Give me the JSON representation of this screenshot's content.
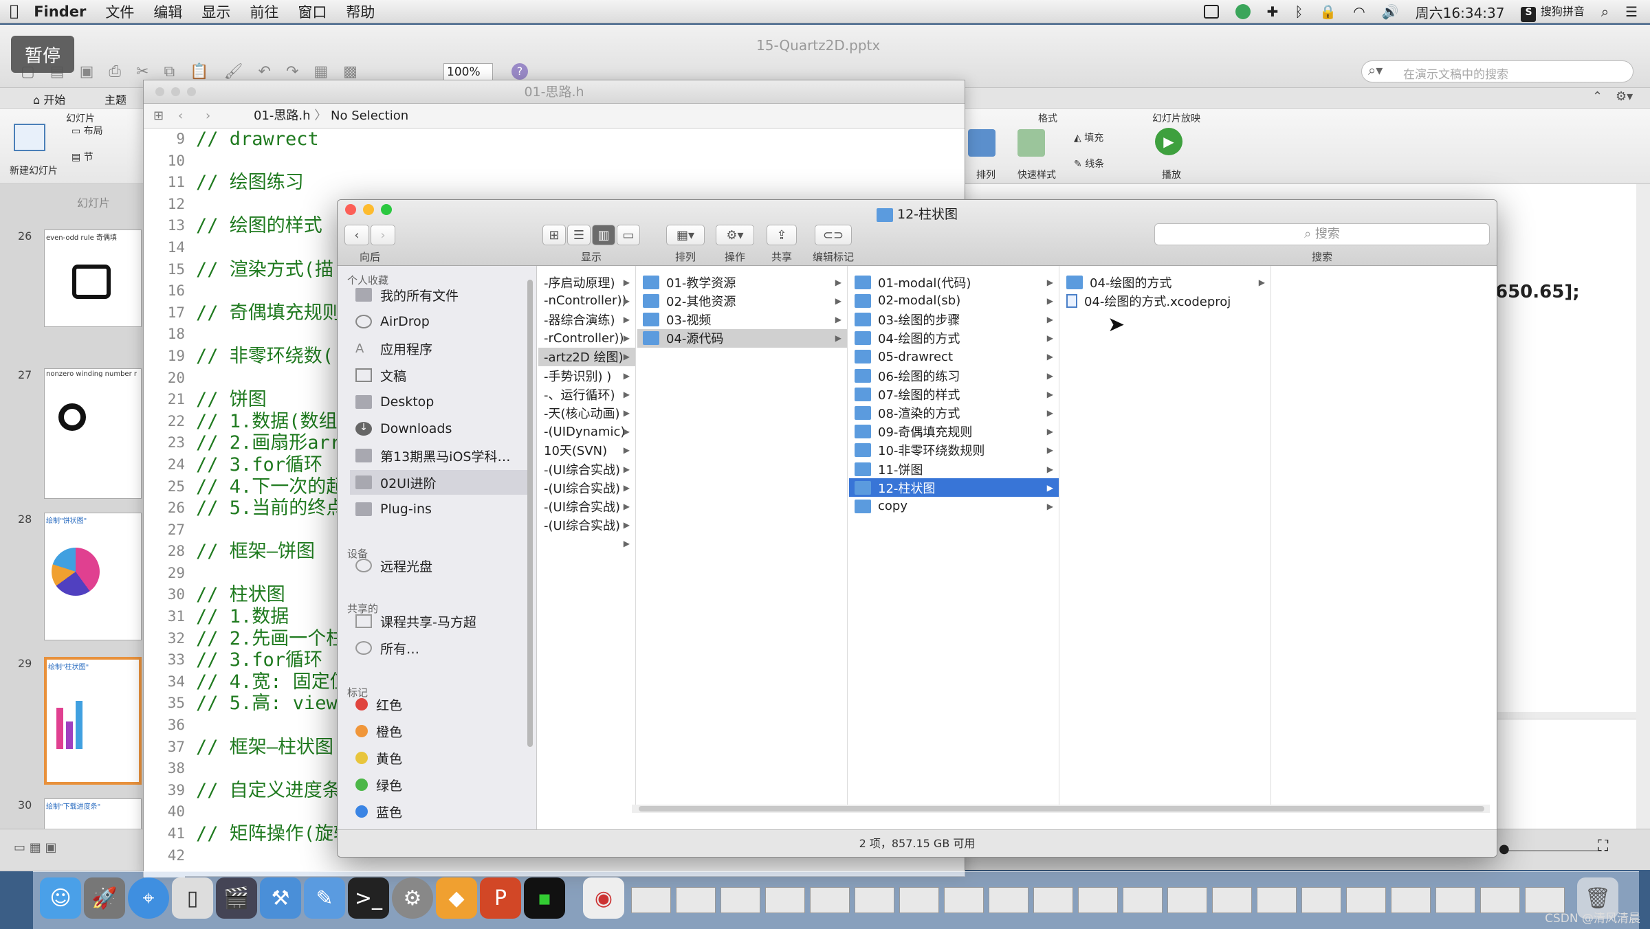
{
  "menubar": {
    "apple": "",
    "app": "Finder",
    "items": [
      "文件",
      "编辑",
      "显示",
      "前往",
      "窗口",
      "帮助"
    ],
    "clock": "周六16:34:37",
    "input_method": "搜狗拼音"
  },
  "pause_label": "暂停",
  "ppt": {
    "title": "15-Quartz2D.pptx",
    "zoom": "100%",
    "search_placeholder": "在演示文稿中的搜索",
    "tabs": [
      "开始",
      "主题"
    ],
    "groups": {
      "slides": "幻灯片",
      "format": "格式",
      "slideshow": "幻灯片放映"
    },
    "buttons": {
      "new_slide": "新建幻灯片",
      "layout": "布局",
      "section": "节",
      "arrange": "排列",
      "quick_style": "快速样式",
      "fill": "填充",
      "line": "线条",
      "play": "播放"
    },
    "slide_tab": "幻灯片",
    "slide_numbers": [
      "26",
      "27",
      "28",
      "29",
      "30"
    ],
    "slide_texts": [
      "even-odd rule 奇偶填",
      "nonzero winding number r",
      "绘制\"饼状图\"",
      "绘制\"柱状图\"",
      "绘制\"下载进度条\""
    ],
    "code_fragment": "650.65];"
  },
  "xcode": {
    "title": "01-思路.h",
    "jump_file": "01-思路.h",
    "jump_sel": "No Selection",
    "line_numbers": [
      "9",
      "10",
      "11",
      "12",
      "13",
      "14",
      "15",
      "16",
      "17",
      "18",
      "19",
      "20",
      "21",
      "22",
      "23",
      "24",
      "25",
      "26",
      "27",
      "28",
      "29",
      "30",
      "31",
      "32",
      "33",
      "34",
      "35",
      "36",
      "37",
      "38",
      "39",
      "40",
      "41",
      "42"
    ],
    "lines": [
      "// drawrect",
      "",
      "// 绘图练习",
      "",
      "// 绘图的样式",
      "",
      "// 渲染方式(描",
      "",
      "// 奇偶填充规则",
      "",
      "// 非零环绕数(",
      "",
      "// 饼图",
      "// 1.数据(数组",
      "// 2.画扇形arr",
      "// 3.for循环",
      "// 4.下一次的起",
      "// 5.当前的终点",
      "",
      "// 框架—饼图",
      "",
      "// 柱状图",
      "// 1.数据",
      "// 2.先画一个柱",
      "// 3.for循环",
      "// 4.宽: 固定值",
      "// 5.高: view",
      "",
      "// 框架—柱状图",
      "",
      "// 自定义进度条",
      "",
      "// 矩阵操作(旋转",
      ""
    ]
  },
  "finder": {
    "title": "12-柱状图",
    "toolbar": {
      "back": "向后",
      "view": "显示",
      "arrange": "排列",
      "action": "操作",
      "share": "共享",
      "tags": "编辑标记",
      "search": "搜索",
      "search_placeholder": "搜索"
    },
    "sidebar": {
      "favorites_header": "个人收藏",
      "favorites": [
        "我的所有文件",
        "AirDrop",
        "应用程序",
        "文稿",
        "Desktop",
        "Downloads",
        "第13期黑马iOS学科…",
        "02UI进阶",
        "Plug-ins"
      ],
      "devices_header": "设备",
      "devices": [
        "远程光盘"
      ],
      "shared_header": "共享的",
      "shared": [
        "课程共享-马方超",
        "所有…"
      ],
      "tags_header": "标记",
      "tags": [
        {
          "label": "红色",
          "color": "#e0443e"
        },
        {
          "label": "橙色",
          "color": "#f0963a"
        },
        {
          "label": "黄色",
          "color": "#e8c53c"
        },
        {
          "label": "绿色",
          "color": "#4cb748"
        },
        {
          "label": "蓝色",
          "color": "#3a84e4"
        }
      ]
    },
    "col1": [
      "-序启动原理)",
      "-nController))",
      "-器综合演练)",
      "-rController))",
      "-artz2D 绘图)",
      "-手势识别) )",
      "-、运行循环)",
      "-天(核心动画)",
      "-(UIDynamic)",
      "10天(SVN)",
      "-(UI综合实战)",
      "-(UI综合实战)",
      "-(UI综合实战)",
      "-(UI综合实战)",
      ""
    ],
    "col2": [
      "01-教学资源",
      "02-其他资源",
      "03-视频",
      "04-源代码"
    ],
    "col3": [
      "01-modal(代码)",
      "02-modal(sb)",
      "03-绘图的步骤",
      "04-绘图的方式",
      "05-drawrect",
      "06-绘图的练习",
      "07-绘图的样式",
      "08-渲染的方式",
      "09-奇偶填充规则",
      "10-非零环绕数规则",
      "11-饼图",
      "12-柱状图",
      "copy"
    ],
    "col4": [
      "04-绘图的方式",
      "04-绘图的方式.xcodeproj"
    ],
    "status": "2 项，857.15 GB 可用"
  },
  "watermark": "CSDN @清风清晨"
}
